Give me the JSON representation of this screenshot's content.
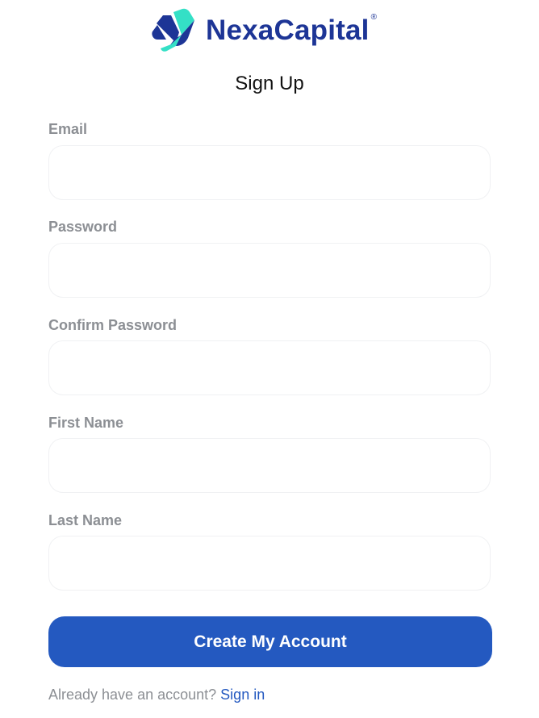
{
  "brand": {
    "name": "NexaCapital",
    "registered_mark": "®",
    "logo_icon": "nexacapital-logo-icon",
    "colors": {
      "navy": "#1d3596",
      "teal": "#34e0c6",
      "primary": "#2459c0",
      "label": "#8c8f94"
    }
  },
  "page": {
    "title": "Sign Up"
  },
  "form": {
    "email": {
      "label": "Email",
      "value": "",
      "placeholder": ""
    },
    "password": {
      "label": "Password",
      "value": "",
      "placeholder": ""
    },
    "confirm_password": {
      "label": "Confirm Password",
      "value": "",
      "placeholder": ""
    },
    "first_name": {
      "label": "First Name",
      "value": "",
      "placeholder": ""
    },
    "last_name": {
      "label": "Last Name",
      "value": "",
      "placeholder": ""
    },
    "submit_label": "Create My Account"
  },
  "footer": {
    "prompt": "Already have an account?",
    "link_label": "Sign in"
  }
}
